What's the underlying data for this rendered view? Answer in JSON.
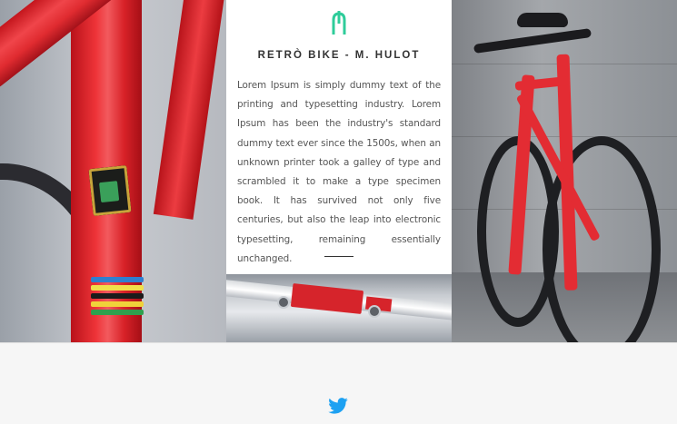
{
  "hero": {
    "left_image": "red bicycle frame close-up",
    "rim_image": "rim",
    "right_image": "red bicycle leaning against wall"
  },
  "card": {
    "logo_icon": "fork-logo-icon",
    "title": "RETRÒ BIKE - M. HULOT",
    "body": "Lorem Ipsum is simply dummy text of the printing and typesetting industry. Lorem Ipsum has been the industry's standard dummy text ever since the 1500s, when an unknown printer took a galley of type and scrambled it to make a type specimen book. It has survived not only five centuries, but also the leap into electronic typesetting, remaining essentially unchanged."
  },
  "footer": {
    "social_icon": "twitter-icon"
  },
  "colors": {
    "accent": "#2ecc9a",
    "twitter": "#1da1f2",
    "frame_red": "#e32c33",
    "background": "#f6f6f6"
  }
}
